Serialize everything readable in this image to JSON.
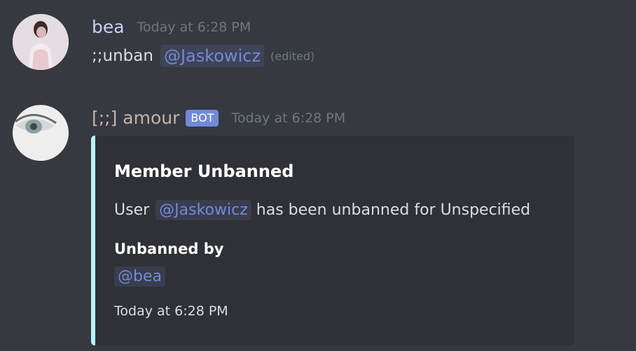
{
  "messages": [
    {
      "username": "bea",
      "username_color": "#c9cdfb",
      "timestamp": "Today at 6:28 PM",
      "content_prefix": ";;unban",
      "mention": "@Jaskowicz",
      "edited": "(edited)"
    },
    {
      "username": "[;;] amour",
      "username_color": "#c6b2ad",
      "bot_tag": "BOT",
      "timestamp": "Today at 6:28 PM",
      "embed": {
        "accent_color": "#b5f7ff",
        "title": "Member Unbanned",
        "description_prefix": "User",
        "description_mention": "@Jaskowicz",
        "description_suffix": "has been unbanned for Unspecified",
        "field_name": "Unbanned by",
        "field_value": "@bea",
        "footer": "Today at 6:28 PM"
      }
    }
  ],
  "colors": {
    "background": "#36393f",
    "embed_background": "#2f3136",
    "mention": "#7289da",
    "muted": "#72767d"
  }
}
